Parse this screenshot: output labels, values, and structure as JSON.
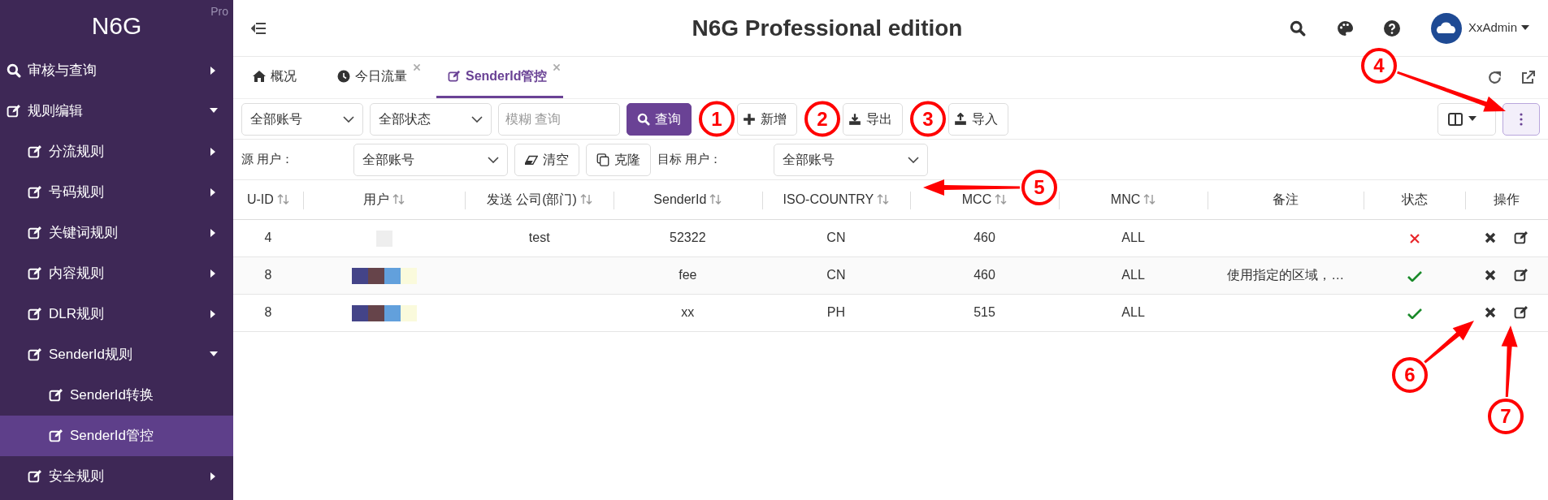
{
  "sidebar": {
    "logo": "N6G",
    "edition": "Pro",
    "items": [
      {
        "label": "审核与查询",
        "expanded": false,
        "selected": false
      },
      {
        "label": "规则编辑",
        "expanded": true,
        "selected": false,
        "children": [
          {
            "label": "分流规则",
            "expanded": false,
            "selected": false
          },
          {
            "label": "号码规则",
            "expanded": false,
            "selected": false
          },
          {
            "label": "关键词规则",
            "expanded": false,
            "selected": false
          },
          {
            "label": "内容规则",
            "expanded": false,
            "selected": false
          },
          {
            "label": "DLR规则",
            "expanded": false,
            "selected": false
          },
          {
            "label": "SenderId规则",
            "expanded": true,
            "selected": false,
            "children": [
              {
                "label": "SenderId转换",
                "selected": false
              },
              {
                "label": "SenderId管控",
                "selected": true
              }
            ]
          },
          {
            "label": "安全规则",
            "expanded": false,
            "selected": false
          }
        ]
      }
    ]
  },
  "header": {
    "title": "N6G Professional edition",
    "user": "XxAdmin"
  },
  "tabs": [
    {
      "label": "概况",
      "closable": false,
      "selected": false
    },
    {
      "label": "今日流量",
      "closable": true,
      "selected": false
    },
    {
      "label": "SenderId管控",
      "closable": true,
      "selected": true
    }
  ],
  "toolbar": {
    "account_select": "全部账号",
    "status_select": "全部状态",
    "search": {
      "placeholder": "模糊 查询"
    },
    "query_button": "查询",
    "buttons": [
      "新增",
      "导出",
      "导入"
    ]
  },
  "clone_bar": {
    "source_label": "源 用户：",
    "source_select": "全部账号",
    "clear_button": "清空",
    "clone_button": "克隆",
    "target_label": "目标 用户：",
    "target_select": "全部账号"
  },
  "table": {
    "columns": [
      {
        "label": "U-ID",
        "sortable": true
      },
      {
        "label": "用户",
        "sortable": true
      },
      {
        "label": "发送 公司(部门)",
        "sortable": true
      },
      {
        "label": "SenderId",
        "sortable": true
      },
      {
        "label": "ISO-COUNTRY",
        "sortable": true
      },
      {
        "label": "MCC",
        "sortable": true
      },
      {
        "label": "MNC",
        "sortable": true
      },
      {
        "label": "备注",
        "sortable": false
      },
      {
        "label": "状态",
        "sortable": false
      },
      {
        "label": "操作",
        "sortable": false
      }
    ],
    "rows": [
      {
        "uid": "4",
        "user": {
          "kind": "blank"
        },
        "company": "test",
        "sender_id": "52322",
        "iso": "CN",
        "mcc": "460",
        "mnc": "ALL",
        "enabled": false
      },
      {
        "uid": "8",
        "user": {
          "kind": "mosaic"
        },
        "sender_id": "fee",
        "iso": "CN",
        "mcc": "460",
        "mnc": "ALL",
        "note": "使用指定的区域，…",
        "enabled": true
      },
      {
        "uid": "8",
        "user": {
          "kind": "mosaic"
        },
        "sender_id": "xx",
        "iso": "PH",
        "mcc": "515",
        "mnc": "ALL",
        "enabled": true
      }
    ]
  },
  "annotations": [
    "1",
    "2",
    "3",
    "4",
    "5",
    "6",
    "7"
  ]
}
